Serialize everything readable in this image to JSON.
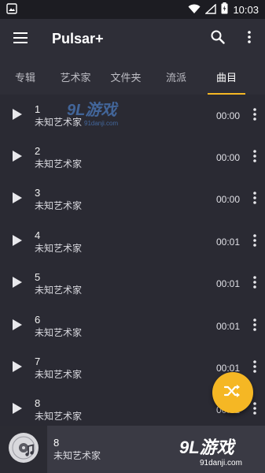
{
  "status_bar": {
    "time": "10:03"
  },
  "toolbar": {
    "title": "Pulsar+"
  },
  "tabs": [
    {
      "label": "专辑",
      "active": false
    },
    {
      "label": "艺术家",
      "active": false
    },
    {
      "label": "文件夹",
      "active": false
    },
    {
      "label": "流派",
      "active": false
    },
    {
      "label": "曲目",
      "active": true
    }
  ],
  "tracks": [
    {
      "title": "1",
      "artist": "未知艺术家",
      "duration": "00:00"
    },
    {
      "title": "2",
      "artist": "未知艺术家",
      "duration": "00:00"
    },
    {
      "title": "3",
      "artist": "未知艺术家",
      "duration": "00:00"
    },
    {
      "title": "4",
      "artist": "未知艺术家",
      "duration": "00:01"
    },
    {
      "title": "5",
      "artist": "未知艺术家",
      "duration": "00:01"
    },
    {
      "title": "6",
      "artist": "未知艺术家",
      "duration": "00:01"
    },
    {
      "title": "7",
      "artist": "未知艺术家",
      "duration": "00:01"
    },
    {
      "title": "8",
      "artist": "未知艺术家",
      "duration": "00:01"
    }
  ],
  "now_playing": {
    "title": "8",
    "artist": "未知艺术家"
  },
  "watermark": {
    "logo": "9L游戏",
    "url": "91danji.com"
  },
  "colors": {
    "accent": "#f5b724",
    "background": "#2a2a33",
    "toolbar": "#2e2e37",
    "player_bar": "#3a3a44"
  }
}
